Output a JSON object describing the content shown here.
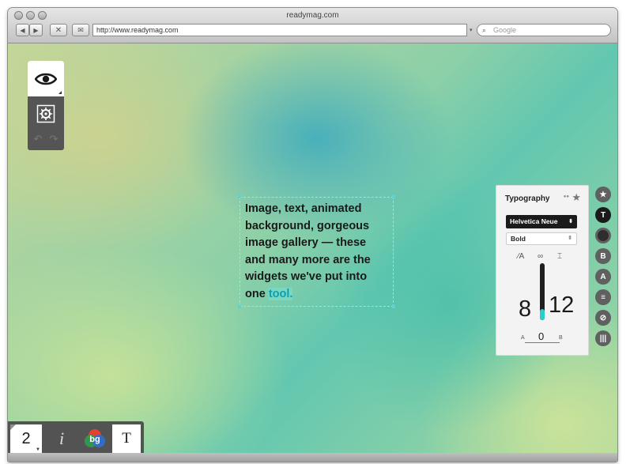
{
  "window": {
    "title": "readymag.com"
  },
  "toolbar": {
    "url": "http://www.readymag.com",
    "search_placeholder": "Google"
  },
  "editor": {
    "text_block": {
      "before": "Image, text, animated background, gorgeous image gallery — these and many more are the widgets we've put into one ",
      "highlight": "tool."
    }
  },
  "typography": {
    "title": "Typography",
    "font": "Helvetica Neue",
    "weight": "Bold",
    "size": "8",
    "leading": "12",
    "tracking": "0",
    "tracking_min": "A",
    "tracking_max": "B",
    "size_fraction": 0.2
  },
  "sidebar_icons": [
    {
      "name": "star-icon",
      "glyph": "★"
    },
    {
      "name": "typography-icon",
      "glyph": "T"
    },
    {
      "name": "circle-icon",
      "glyph": ""
    },
    {
      "name": "button-icon",
      "glyph": "B"
    },
    {
      "name": "text-style-icon",
      "glyph": "A"
    },
    {
      "name": "comment-icon",
      "glyph": "≡"
    },
    {
      "name": "link-icon",
      "glyph": "⊘"
    },
    {
      "name": "columns-icon",
      "glyph": "|||"
    }
  ],
  "bottom_toolbar": {
    "page_number": "2",
    "info_label": "i",
    "bg_label": "bg",
    "text_label": "T"
  },
  "colors": {
    "accent": "#29d0c9",
    "panel_dark": "#535353"
  }
}
